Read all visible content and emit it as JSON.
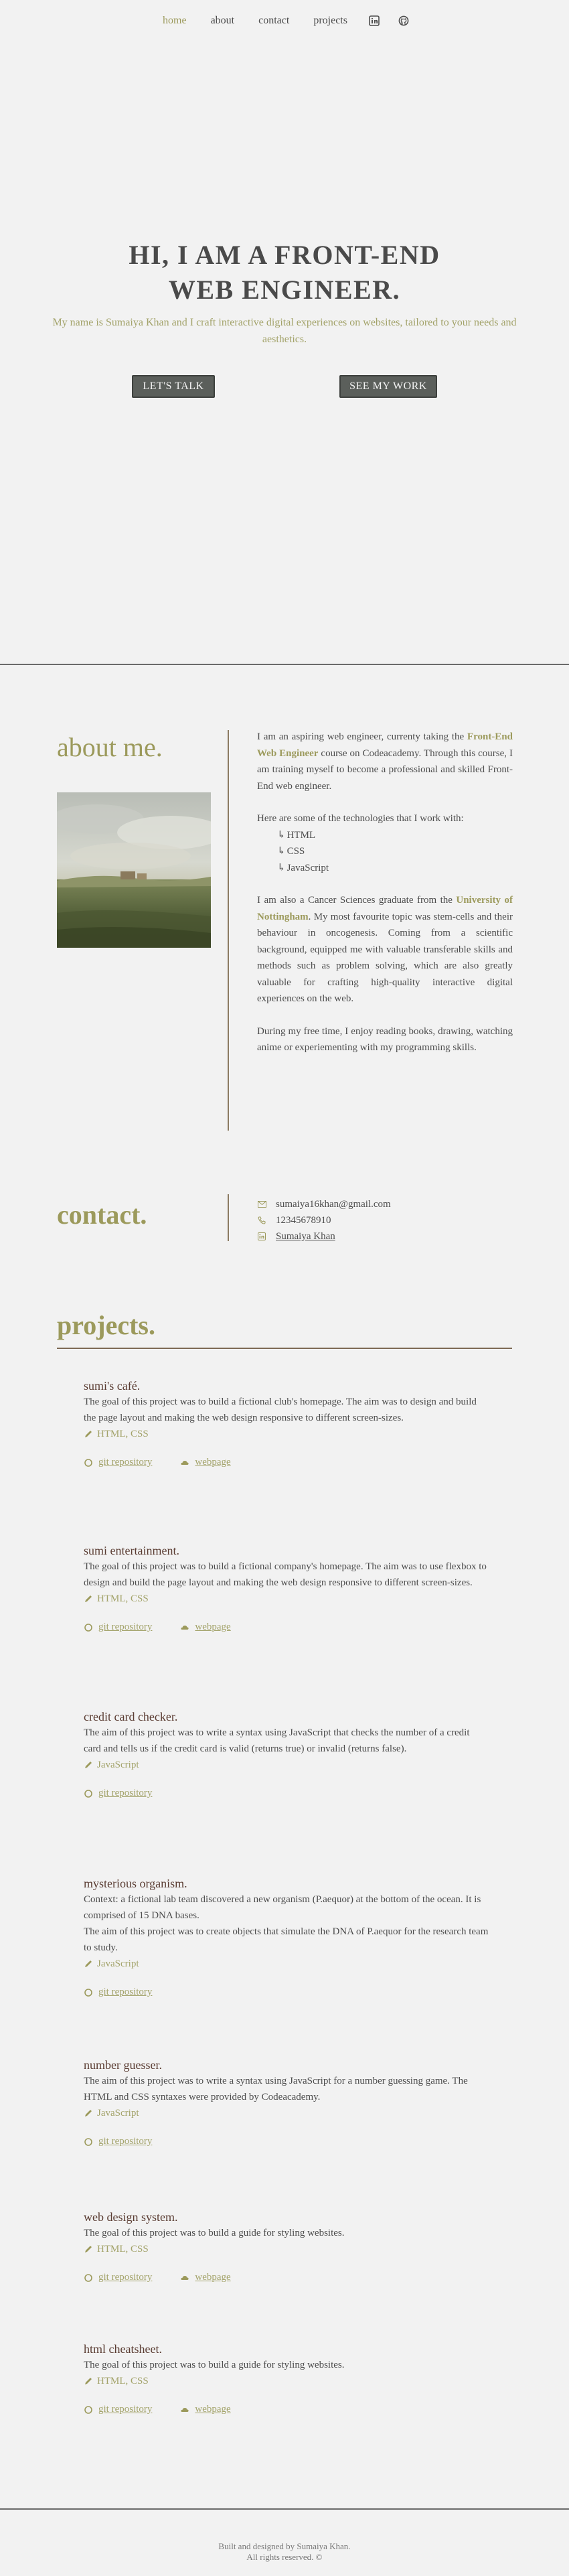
{
  "nav": {
    "items": [
      "home",
      "about",
      "contact",
      "projects"
    ],
    "icons": [
      "linkedin-icon",
      "github-icon"
    ]
  },
  "hero": {
    "title": "HI, I AM A FRONT-END WEB ENGINEER.",
    "subtitle": "My name is Sumaiya Khan and I craft interactive digital experiences on websites, tailored to your needs and aesthetics.",
    "btn_talk": "LET'S TALK",
    "btn_work": "SEE MY WORK"
  },
  "about": {
    "title": "about me.",
    "p1_a": "I am an aspiring web engineer, currenty taking the ",
    "p1_hl": "Front-End Web Engineer",
    "p1_b": " course on Codeacademy. Through this course, I am training myself to become a professional and skilled Front-End web engineer.",
    "p2": "Here are some of the technologies that I work with:",
    "tech": [
      "HTML",
      "CSS",
      "JavaScript"
    ],
    "p3_a": "I am also a Cancer Sciences graduate from the ",
    "p3_hl": "University of Nottingham",
    "p3_b": ". My most favourite topic was stem-cells and their behaviour in oncogenesis. Coming from a scientific background, equipped me with valuable transferable skills and methods such as problem solving, which are also greatly valuable for crafting high-quality interactive digital experiences on the web.",
    "p4": "During my free time, I enjoy reading books, drawing, watching anime or experiementing with my programming skills."
  },
  "contact": {
    "title": "contact.",
    "email": "sumaiya16khan@gmail.com",
    "phone": "12345678910",
    "linkedin": "Sumaiya Khan"
  },
  "projects": {
    "title": "projects.",
    "repo_label": "git repository",
    "web_label": "webpage",
    "items": [
      {
        "title": "sumi's café.",
        "desc": "The goal of this project was to build a fictional club's homepage. The aim was to design and build the page layout and making the web design responsive to different screen-sizes.",
        "tech": "HTML, CSS"
      },
      {
        "title": "sumi entertainment.",
        "desc": "The goal of this project was to build a fictional company's homepage. The aim was to use flexbox to design and build the page layout and making the web design responsive to different screen-sizes.",
        "tech": "HTML, CSS"
      },
      {
        "title": "credit card checker.",
        "desc": "The aim of this project was to write a syntax using JavaScript that checks the number of a credit card and tells us if the credit card is valid (returns true) or invalid (returns false).",
        "tech": "JavaScript"
      },
      {
        "title": "mysterious organism.",
        "desc": "Context: a fictional lab team discovered a new organism (P.aequor) at the bottom of the ocean. It is comprised of 15 DNA bases.",
        "desc2": "The aim of this project was to create objects that simulate the DNA of P.aequor for the research team to study.",
        "tech": "JavaScript"
      },
      {
        "title": "number guesser.",
        "desc": "The aim of this project was to write a syntax using JavaScript for a number guessing game. The HTML and CSS syntaxes were provided by Codeacademy.",
        "tech": "JavaScript"
      },
      {
        "title": "web design system.",
        "desc": "The goal of this project was to build a guide for styling websites.",
        "tech": "HTML, CSS"
      },
      {
        "title": "html cheatsheet.",
        "desc": "The goal of this project was to build a guide for styling websites.",
        "tech": "HTML, CSS"
      }
    ]
  },
  "footer": {
    "line1": "Built and designed by Sumaiya Khan.",
    "line2": "All rights reserved. ©"
  },
  "colors": {
    "accent": "#9c9a5c",
    "title_brown": "#5a3c32",
    "background": "#f2f2f2",
    "text": "#4d4d4d"
  }
}
